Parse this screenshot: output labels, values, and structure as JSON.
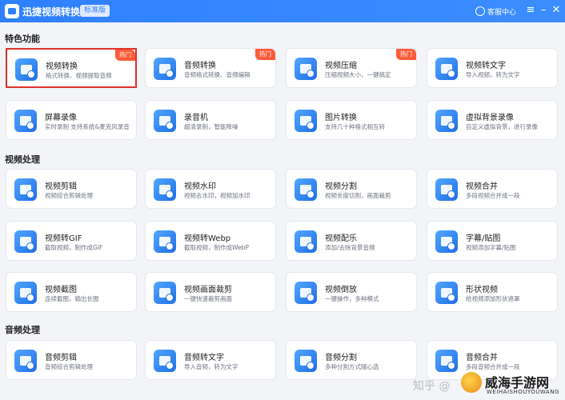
{
  "app": {
    "title": "迅捷视频转换器",
    "version_badge": "标准版",
    "service": "客服中心",
    "controls": {
      "menu": "≡",
      "minimize": "–",
      "close": "✕"
    }
  },
  "sections": {
    "featured": {
      "title": "特色功能"
    },
    "video": {
      "title": "视频处理"
    },
    "audio": {
      "title": "音频处理"
    }
  },
  "cards": [
    {
      "name": "视频转换",
      "desc": "格式转换、视频提取音频",
      "hot": "热门"
    },
    {
      "name": "音频转换",
      "desc": "音频格式转换、音频编辑",
      "hot": "热门"
    },
    {
      "name": "视频压缩",
      "desc": "压缩视频大小，一键搞定",
      "hot": "热门"
    },
    {
      "name": "视频转文字",
      "desc": "导入视频，转为文字"
    },
    {
      "name": "屏幕录像",
      "desc": "实时录制 支持系统&麦克风录音"
    },
    {
      "name": "录音机",
      "desc": "超清录制，智能降噪"
    },
    {
      "name": "图片转换",
      "desc": "支持几十种格式相互转"
    },
    {
      "name": "虚拟背景录像",
      "desc": "自定义虚拟背景，进行录像"
    },
    {
      "name": "视频剪辑",
      "desc": "视频综合剪辑处理"
    },
    {
      "name": "视频水印",
      "desc": "视频去水印，视频加水印"
    },
    {
      "name": "视频分割",
      "desc": "视频长度切割，画面裁剪"
    },
    {
      "name": "视频合并",
      "desc": "多段视频合并成一段"
    },
    {
      "name": "视频转GIF",
      "desc": "截取视频，制作成GIF"
    },
    {
      "name": "视频转Webp",
      "desc": "截取视频，制作成WebP"
    },
    {
      "name": "视频配乐",
      "desc": "添加/去除背景音频"
    },
    {
      "name": "字幕/贴图",
      "desc": "视频添加字幕/贴图"
    },
    {
      "name": "视频截图",
      "desc": "连续截图，输出长图"
    },
    {
      "name": "视频画面裁剪",
      "desc": "一键快速裁剪画面"
    },
    {
      "name": "视频倒放",
      "desc": "一键操作，多种模式"
    },
    {
      "name": "形状视频",
      "desc": "给视频添加形状遮罩"
    },
    {
      "name": "音频剪辑",
      "desc": "音频综合剪辑处理"
    },
    {
      "name": "音频转文字",
      "desc": "导入音频，转为文字"
    },
    {
      "name": "音频分割",
      "desc": "多种分割方式随心选"
    },
    {
      "name": "音频合并",
      "desc": "多段音频合并成一段"
    }
  ],
  "watermark": {
    "zhihu": "知乎 @",
    "brand": "威海手游网",
    "brand_en": "WEIHAISHOUYOUWANG"
  },
  "colors": {
    "titlebar": "#2f80ff",
    "hot_badge": "#ff5b3a",
    "selection_border": "#e0322b"
  }
}
